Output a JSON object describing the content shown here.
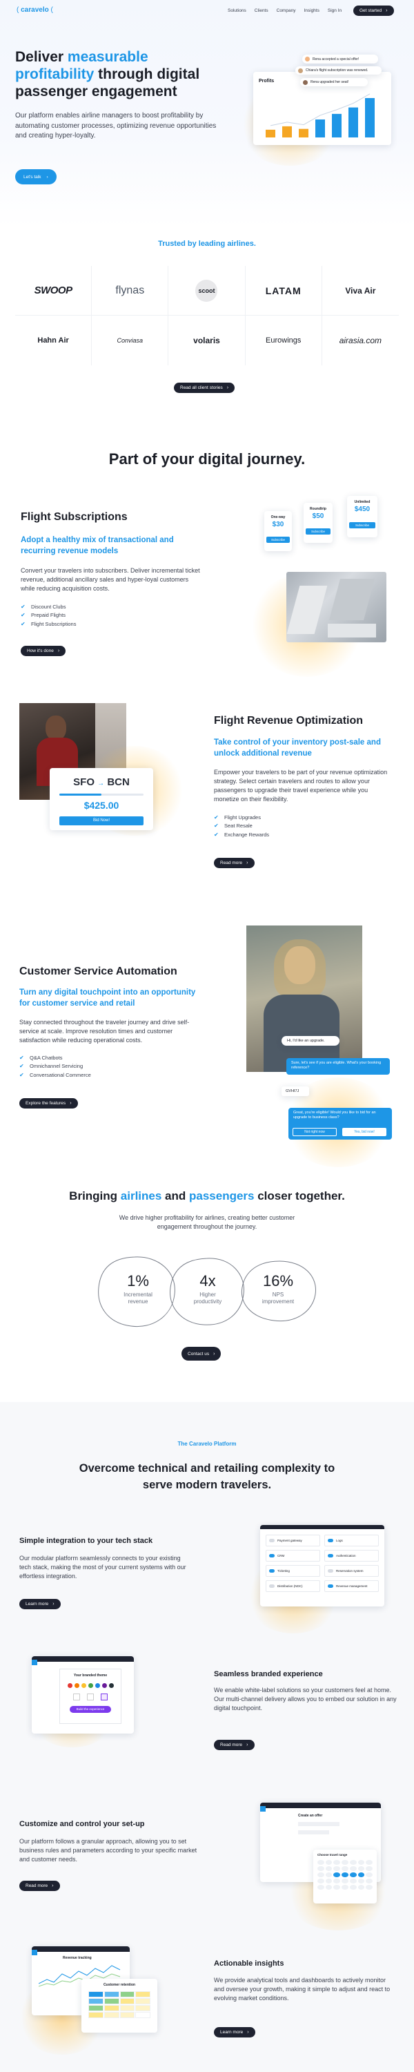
{
  "nav": {
    "logo": "caravelo",
    "items": [
      "Solutions",
      "Clients",
      "Company",
      "Insights",
      "Sign In"
    ],
    "cta": "Get started"
  },
  "hero": {
    "title_pre": "Deliver ",
    "title_accent": "measurable profitability",
    "title_post": " through digital passenger engagement",
    "body": "Our platform enables airline managers to boost profitability by automating customer processes, optimizing revenue opportunities and creating hyper-loyalty.",
    "cta": "Let's talk",
    "chart_card": {
      "title": "Profits",
      "notes": [
        "Rena accepted a special offer!",
        "Chiara's flight subscription was renewed.",
        "Rena upgraded her seat!"
      ],
      "bars": [
        0.18,
        0.26,
        0.2,
        0.42,
        0.55,
        0.7,
        0.92
      ],
      "accent": "#1e96e6",
      "orange": "#f5a623"
    }
  },
  "trusted": {
    "title": "Trusted by leading airlines.",
    "logos": [
      "SWOOP",
      "flynas",
      "scoot",
      "LATAM",
      "Viva Air",
      "Hahn Air",
      "Conviasa",
      "volaris",
      "Eurowings",
      "airasia.com"
    ],
    "cta": "Read all client stories"
  },
  "journey_title": "Part of your digital journey.",
  "subscriptions": {
    "title": "Flight Subscriptions",
    "subtitle": "Adopt a healthy mix of transactional and recurring revenue models",
    "body": "Convert your travelers into subscribers. Deliver incremental ticket revenue, additional ancillary sales and hyper-loyal customers while reducing acquisition costs.",
    "checks": [
      "Discount Clubs",
      "Prepaid Flights",
      "Flight Subscriptions"
    ],
    "cta": "How it's done",
    "plans": [
      {
        "name": "One-way",
        "price": "$30",
        "btn": "Subscribe"
      },
      {
        "name": "Roundtrip",
        "price": "$50",
        "btn": "Subscribe"
      },
      {
        "name": "Unlimited",
        "price": "$450",
        "btn": "Subscribe"
      }
    ]
  },
  "revenue": {
    "title": "Flight Revenue Optimization",
    "subtitle": "Take control of your inventory post-sale and unlock additional revenue",
    "body": "Empower your travelers to be part of your revenue optimization strategy. Select certain travelers and routes to allow your passengers to upgrade their travel experience while you monetize on their flexibility.",
    "checks": [
      "Flight Upgrades",
      "Seat Resale",
      "Exchange Rewards"
    ],
    "cta": "Read more",
    "route": {
      "from": "SFO",
      "to": "BCN",
      "price": "$425.00",
      "btn": "Bid Now!"
    }
  },
  "service": {
    "title": "Customer Service Automation",
    "subtitle": "Turn any digital touchpoint into an opportunity for customer service and retail",
    "body": "Stay connected throughout the traveler journey and drive self-service at scale. Improve resolution times and customer satisfaction while reducing operational costs.",
    "checks": [
      "Q&A Chatbots",
      "Omnichannel Servicing",
      "Conversational Commerce"
    ],
    "cta": "Explore the features",
    "chat": {
      "user1": "Hi, I'd like an upgrade.",
      "bot1": "Sure, let's see if you are eligible. What's your booking reference?",
      "user2": "GVHI7J",
      "bot2": "Great, you're eligible! Would you like to bid for an upgrade to business class?",
      "opt1": "Not right now",
      "opt2": "Yes, bid now!"
    }
  },
  "together": {
    "title_pre": "Bringing ",
    "title_a": "airlines",
    "title_mid": " and ",
    "title_b": "passengers",
    "title_post": " closer together.",
    "body": "We drive higher profitability for airlines, creating better customer engagement throughout the journey.",
    "stats": [
      {
        "value": "1%",
        "label": "Incremental revenue"
      },
      {
        "value": "4x",
        "label": "Higher productivity"
      },
      {
        "value": "16%",
        "label": "NPS improvement"
      }
    ],
    "cta": "Contact us"
  },
  "platform": {
    "eyebrow": "The Caravelo Platform",
    "title": "Overcome technical and retailing complexity to serve modern travelers.",
    "features": [
      {
        "title": "Simple integration to your tech stack",
        "body": "Our modular platform seamlessly connects to your existing tech stack, making the most of your current systems with our effortless integration.",
        "cta": "Learn more"
      },
      {
        "title": "Seamless branded experience",
        "body": "We enable white-label solutions so your customers feel at home. Our multi-channel delivery allows you to embed our solution in any digital touchpoint.",
        "cta": "Read more"
      },
      {
        "title": "Customize and control your set-up",
        "body": "Our platform follows a granular approach, allowing you to set business rules and parameters according to your specific market and customer needs.",
        "cta": "Read more"
      },
      {
        "title": "Actionable insights",
        "body": "We provide analytical tools and dashboards to actively monitor and oversee your growth, making it simple to adjust and react to evolving market conditions.",
        "cta": "Learn more"
      }
    ],
    "integrations": [
      "Payment gateway",
      "Logs",
      "CRM",
      "Authentication",
      "Ticketing",
      "Reservation system",
      "Distribution (NDC)",
      "Revenue management"
    ],
    "brand_card": {
      "title": "Your branded theme",
      "btn": "Build the experience"
    },
    "setup_card": {
      "title": "Create an offer",
      "cal_title": "Choose travel range"
    },
    "insights_card": {
      "title": "Revenue tracking",
      "sub": "Customer retention"
    }
  }
}
